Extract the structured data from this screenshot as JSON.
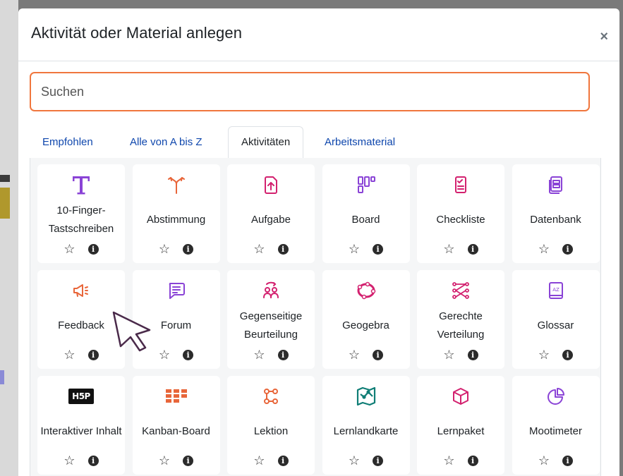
{
  "dialog": {
    "title": "Aktivität oder Material anlegen",
    "close_glyph": "×"
  },
  "search": {
    "placeholder": "Suchen",
    "value": ""
  },
  "tabs": [
    {
      "label": "Empfohlen",
      "active": false
    },
    {
      "label": "Alle von A bis Z",
      "active": false
    },
    {
      "label": "Aktivitäten",
      "active": true
    },
    {
      "label": "Arbeitsmaterial",
      "active": false
    }
  ],
  "actions": {
    "star_glyph": "☆",
    "info_glyph": "i"
  },
  "colors": {
    "search_border": "#f0763d",
    "tab_link": "#0f47ad",
    "icon_purple": "#8a43d6",
    "icon_pink": "#d3216f",
    "icon_orange": "#e8663a",
    "icon_teal": "#0e7d75"
  },
  "activities": [
    {
      "label": "10-Finger-Tastschreiben",
      "icon": "letter-t-icon"
    },
    {
      "label": "Abstimmung",
      "icon": "fork-arrows-icon"
    },
    {
      "label": "Aufgabe",
      "icon": "upload-document-icon"
    },
    {
      "label": "Board",
      "icon": "board-columns-icon"
    },
    {
      "label": "Checkliste",
      "icon": "checklist-icon"
    },
    {
      "label": "Datenbank",
      "icon": "database-icon"
    },
    {
      "label": "Feedback",
      "icon": "megaphone-icon"
    },
    {
      "label": "Forum",
      "icon": "chat-bubble-icon"
    },
    {
      "label": "Gegenseitige Beurteilung",
      "icon": "peer-review-icon"
    },
    {
      "label": "Geogebra",
      "icon": "geogebra-icon"
    },
    {
      "label": "Gerechte Verteilung",
      "icon": "distribution-icon"
    },
    {
      "label": "Glossar",
      "icon": "glossary-book-icon"
    },
    {
      "label": "Interaktiver Inhalt",
      "icon": "h5p-logo-icon",
      "icon_text": "H5P"
    },
    {
      "label": "Kanban-Board",
      "icon": "kanban-icon"
    },
    {
      "label": "Lektion",
      "icon": "lesson-icon"
    },
    {
      "label": "Lernlandkarte",
      "icon": "learning-map-icon"
    },
    {
      "label": "Lernpaket",
      "icon": "package-cube-icon"
    },
    {
      "label": "Mootimeter",
      "icon": "pie-chart-icon"
    }
  ]
}
